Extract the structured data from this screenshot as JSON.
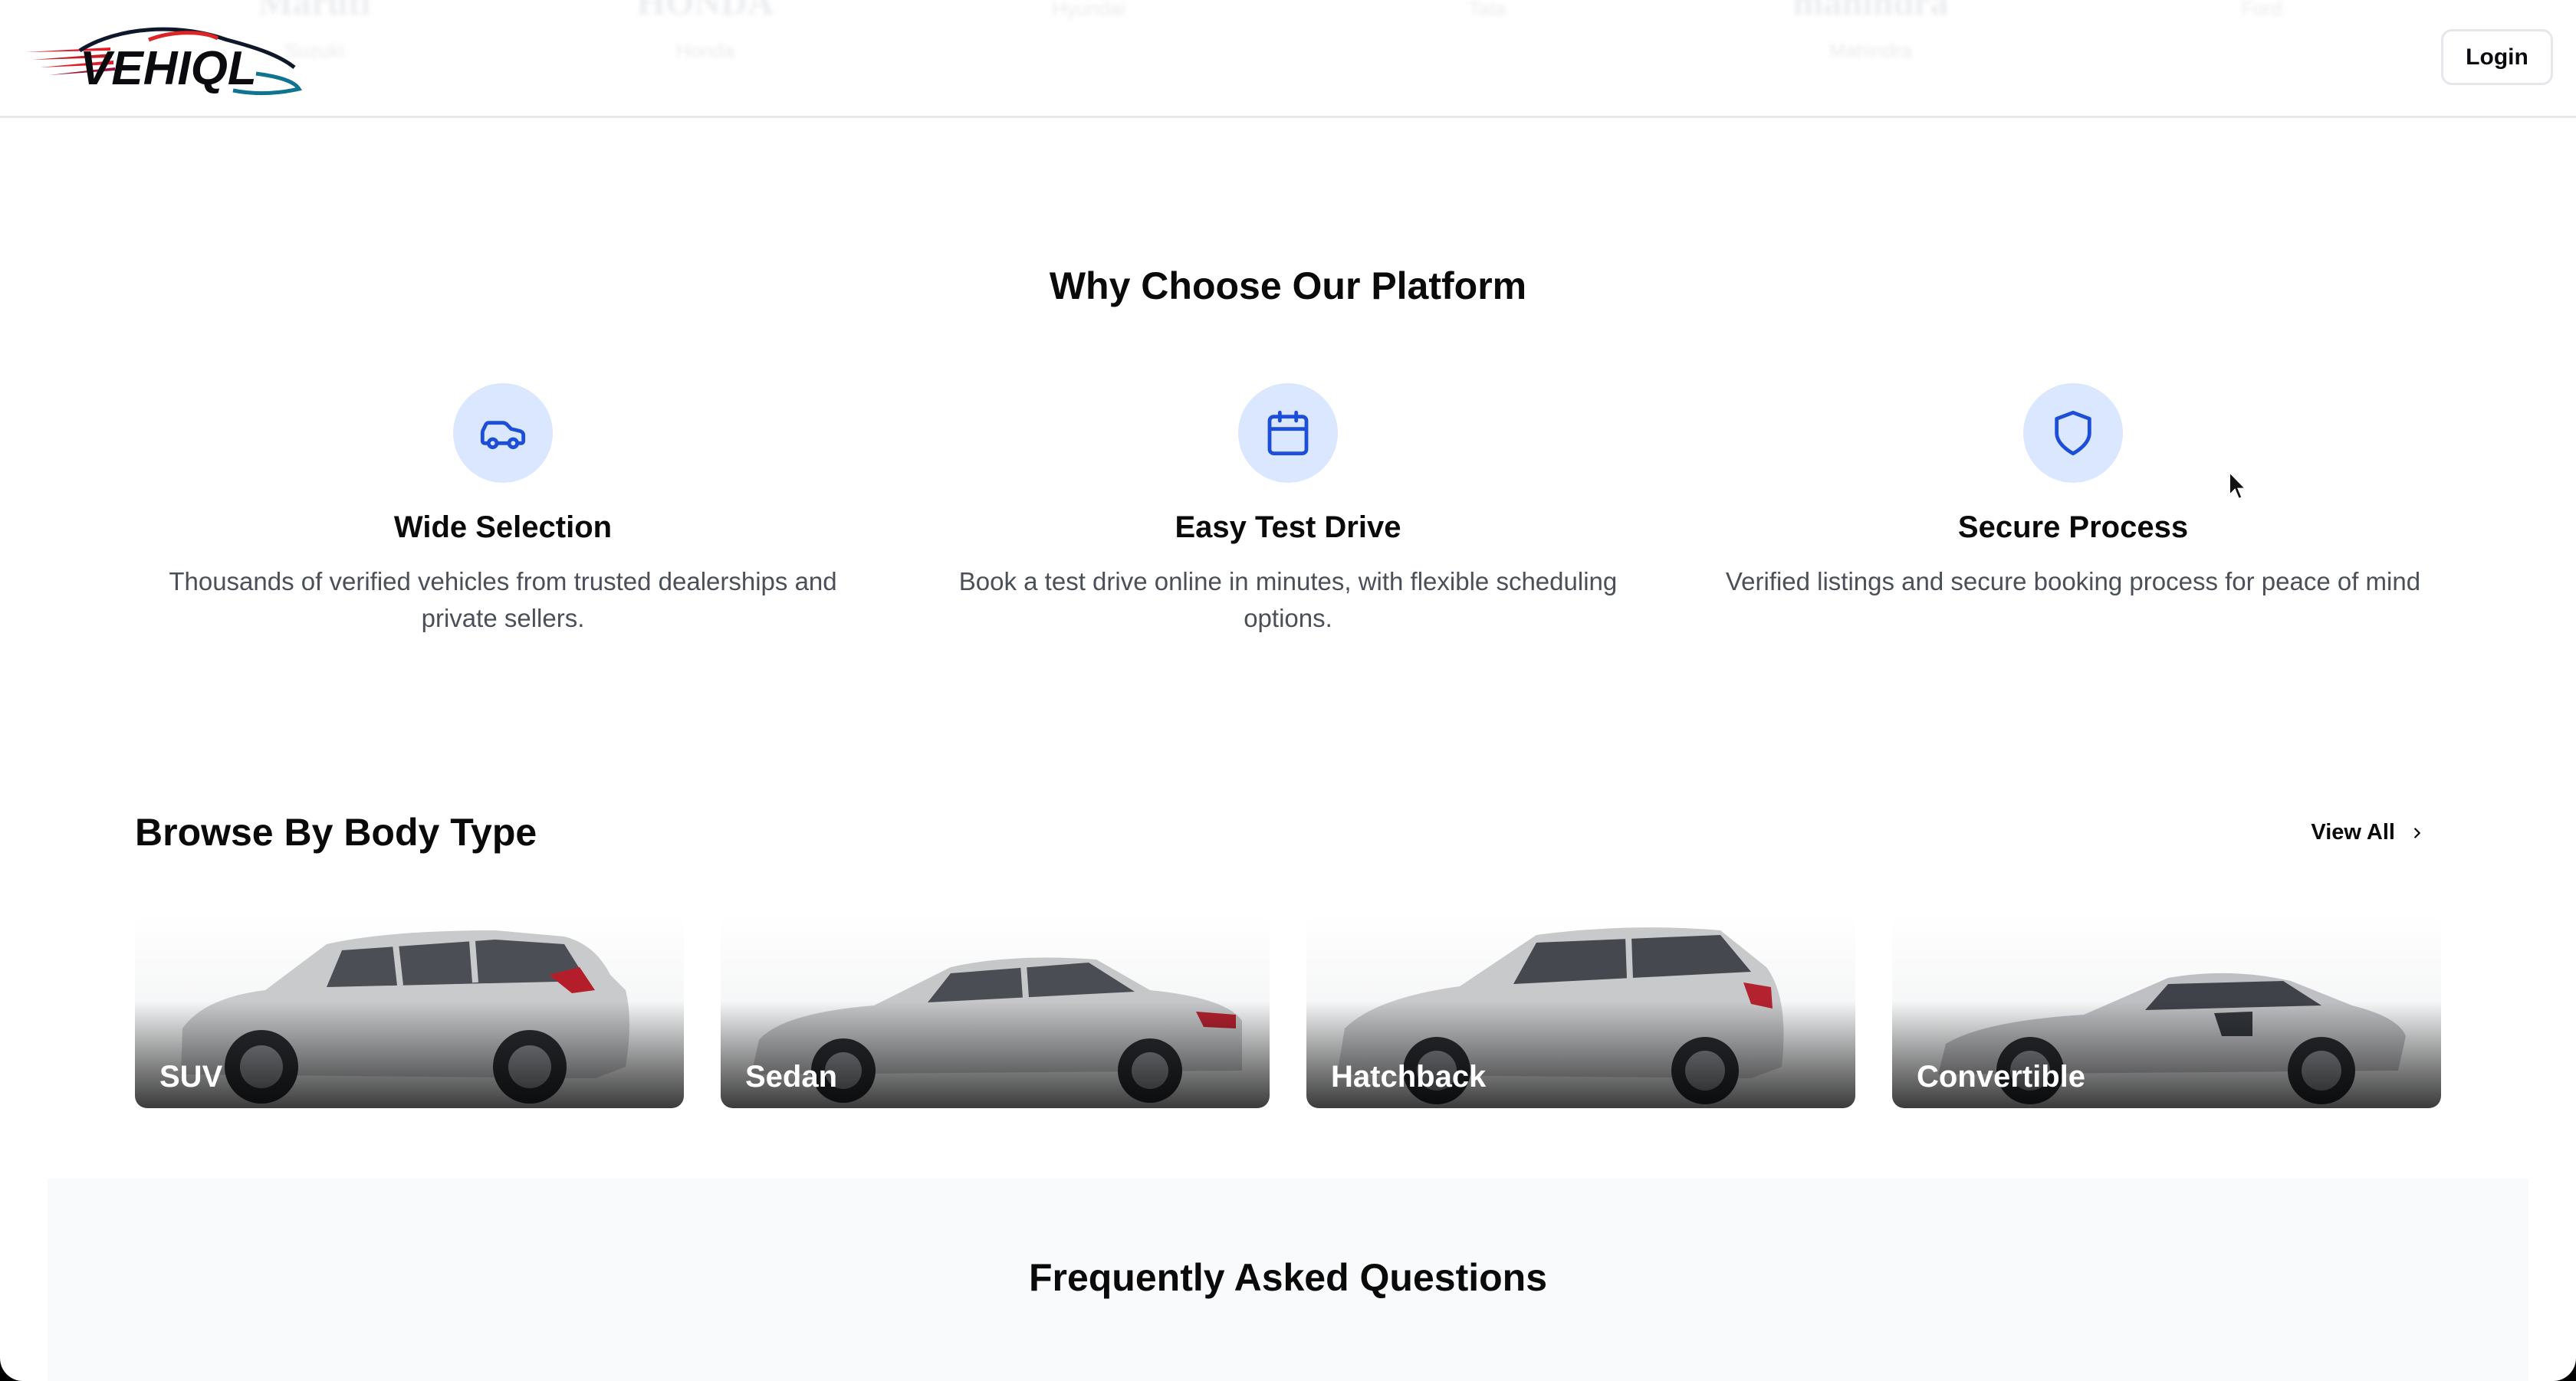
{
  "header": {
    "logo_text": "VEHIQL",
    "login_label": "Login",
    "brand_strip": [
      {
        "name": "Maruti",
        "sub": "Suzuki"
      },
      {
        "name": "HONDA",
        "sub": "Honda"
      },
      {
        "name": "",
        "sub": "Hyundai"
      },
      {
        "name": "",
        "sub": "Tata"
      },
      {
        "name": "mahindra",
        "sub": "Mahindra"
      },
      {
        "name": "",
        "sub": "Ford"
      }
    ]
  },
  "why": {
    "title": "Why Choose Our Platform",
    "features": [
      {
        "icon": "car-icon",
        "title": "Wide Selection",
        "desc": "Thousands of verified vehicles from trusted dealerships and private sellers."
      },
      {
        "icon": "calendar-icon",
        "title": "Easy Test Drive",
        "desc": "Book a test drive online in minutes, with flexible scheduling options."
      },
      {
        "icon": "shield-icon",
        "title": "Secure Process",
        "desc": "Verified listings and secure booking process for peace of mind"
      }
    ]
  },
  "browse": {
    "title": "Browse By Body Type",
    "view_all_label": "View All",
    "types": [
      {
        "label": "SUV"
      },
      {
        "label": "Sedan"
      },
      {
        "label": "Hatchback"
      },
      {
        "label": "Convertible"
      }
    ]
  },
  "faq": {
    "title": "Frequently Asked Questions"
  },
  "colors": {
    "accent": "#1d4ed8",
    "icon_bg": "#dbe7fe",
    "text_muted": "#4b4f57"
  }
}
